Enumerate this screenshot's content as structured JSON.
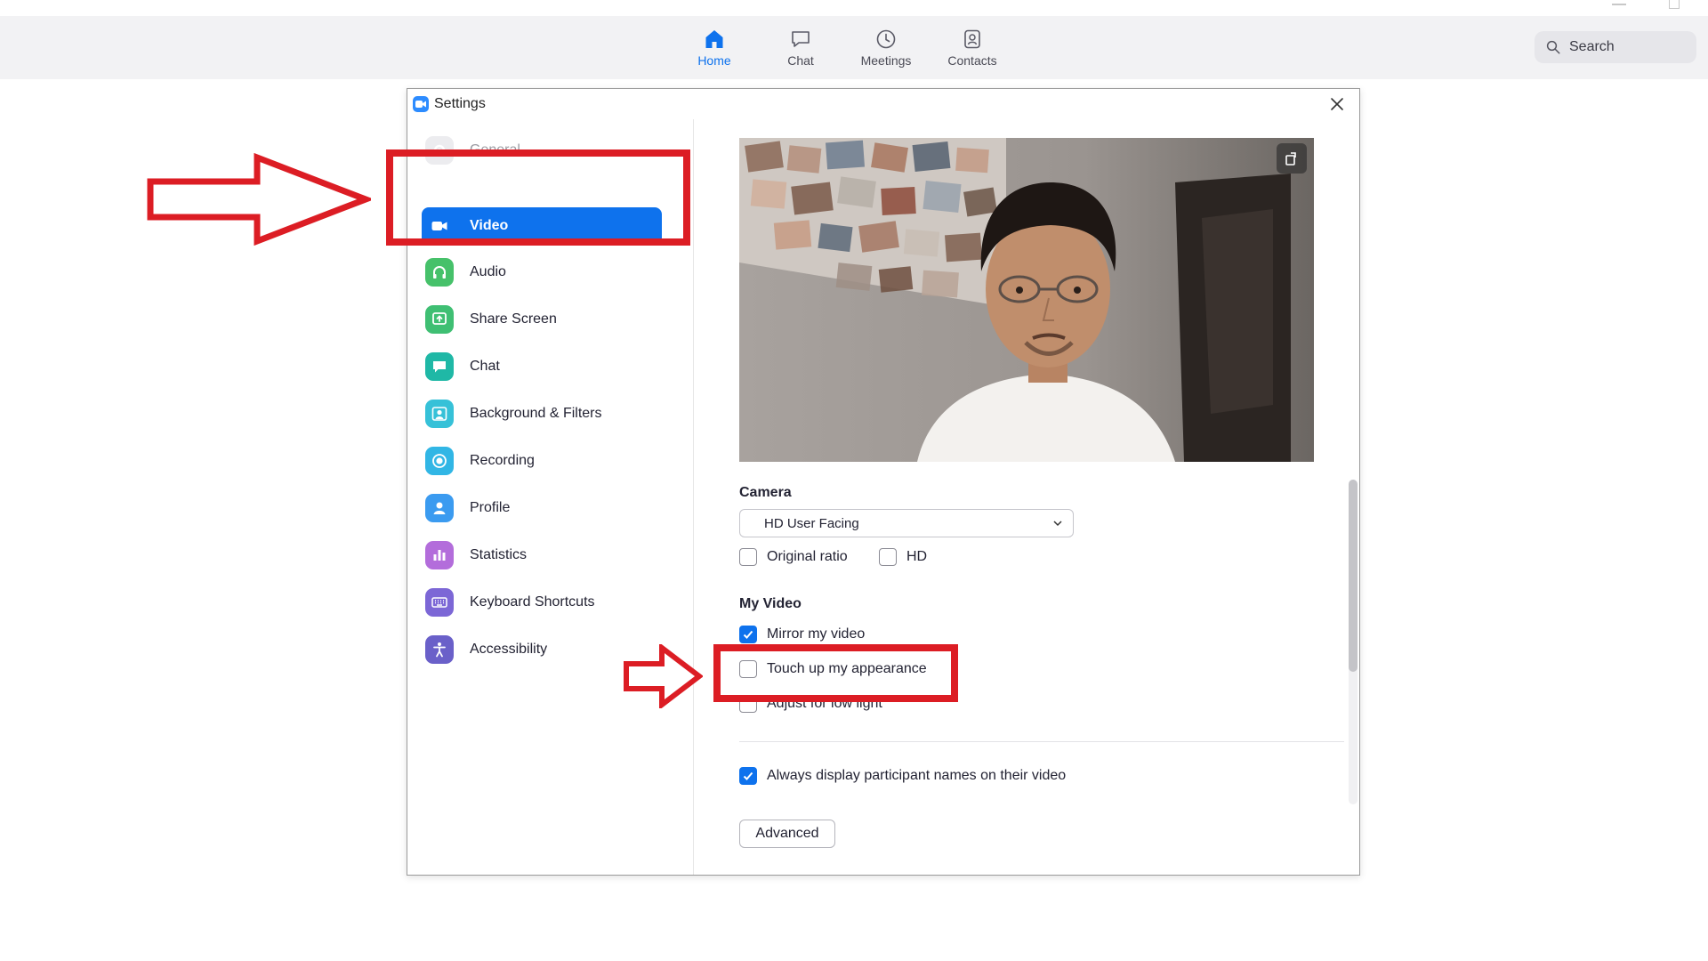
{
  "nav": {
    "tabs": [
      {
        "label": "Home",
        "icon": "home-icon",
        "active": true
      },
      {
        "label": "Chat",
        "icon": "chat-bubble-icon",
        "active": false
      },
      {
        "label": "Meetings",
        "icon": "clock-icon",
        "active": false
      },
      {
        "label": "Contacts",
        "icon": "contact-card-icon",
        "active": false
      }
    ],
    "search_placeholder": "Search"
  },
  "window": {
    "title": "Settings"
  },
  "sidebar": {
    "items": [
      {
        "label": "General",
        "icon": "gear-icon",
        "color": "#c9c9cf"
      },
      {
        "label": "Video",
        "icon": "video-camera-icon",
        "color": "#0e72ed",
        "active": true
      },
      {
        "label": "Audio",
        "icon": "headphones-icon",
        "color": "#3fb950"
      },
      {
        "label": "Share Screen",
        "icon": "share-screen-icon",
        "color": "#3fbf73"
      },
      {
        "label": "Chat",
        "icon": "chat-icon",
        "color": "#1fb8a6"
      },
      {
        "label": "Background & Filters",
        "icon": "background-icon",
        "color": "#36c1d8"
      },
      {
        "label": "Recording",
        "icon": "record-icon",
        "color": "#31b6e5"
      },
      {
        "label": "Profile",
        "icon": "profile-icon",
        "color": "#3b9bf0"
      },
      {
        "label": "Statistics",
        "icon": "statistics-icon",
        "color": "#b36ddb"
      },
      {
        "label": "Keyboard Shortcuts",
        "icon": "keyboard-icon",
        "color": "#7c67d6"
      },
      {
        "label": "Accessibility",
        "icon": "accessibility-icon",
        "color": "#6a60c9"
      }
    ]
  },
  "video": {
    "camera_label": "Camera",
    "camera_value": "HD User Facing",
    "original_ratio": {
      "label": "Original ratio",
      "checked": false
    },
    "hd": {
      "label": "HD",
      "checked": false
    },
    "my_video_label": "My Video",
    "mirror": {
      "label": "Mirror my video",
      "checked": true
    },
    "touch_up": {
      "label": "Touch up my appearance",
      "checked": false
    },
    "low_light": {
      "label": "Adjust for low light",
      "checked": false
    },
    "always_display": {
      "label": "Always display participant names on their video",
      "checked": true
    },
    "advanced_label": "Advanced"
  },
  "colors": {
    "accent": "#0e72ed",
    "annotation_red": "#dc1d24"
  }
}
